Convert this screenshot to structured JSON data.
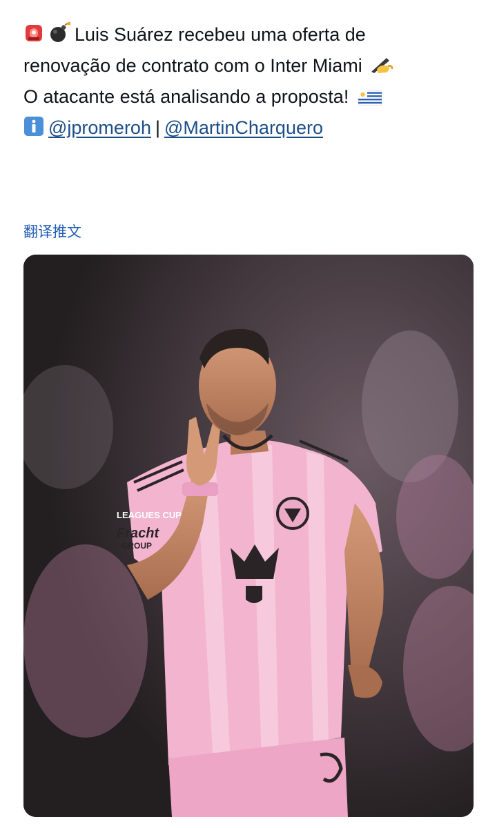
{
  "tweet": {
    "line1": "Luis Suárez recebeu uma oferta de",
    "line2": "renovação de contrato com o Inter Miami",
    "line3": "O atacante está analisando a proposta!",
    "mention1": "@jpromeroh",
    "separator": "|",
    "mention2": "@MartinCharquero"
  },
  "icons": {
    "siren": "rotating-light-icon",
    "bomb": "bomb-icon",
    "writing": "writing-hand-icon",
    "flag": "uruguay-flag-icon",
    "info": "information-icon"
  },
  "translate_label": "翻译推文",
  "media": {
    "jersey_text_leagues": "LEAGUES CUP",
    "jersey_text_sponsor": "Fracht",
    "jersey_text_group": "GROUP",
    "colors": {
      "jersey_pink": "#f3b4cf",
      "background": "#2a2426",
      "link": "#1d4e89"
    }
  }
}
